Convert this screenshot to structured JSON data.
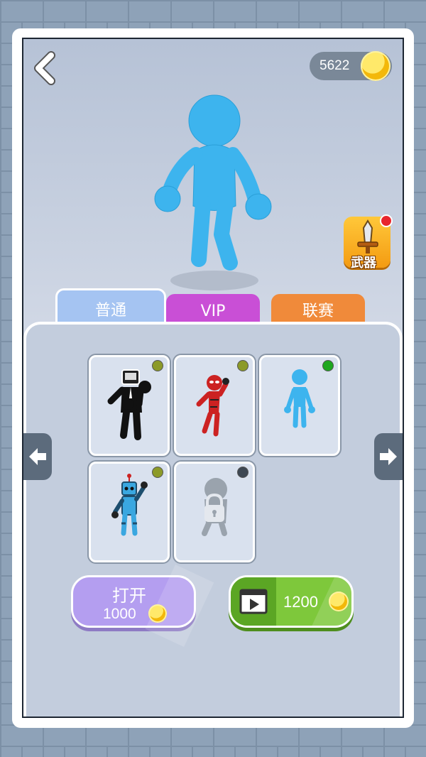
{
  "header": {
    "coins": "5622"
  },
  "weapon_button": {
    "label": "武器"
  },
  "tabs": [
    {
      "label": "普通",
      "active": true
    },
    {
      "label": "VIP",
      "active": false
    },
    {
      "label": "联赛",
      "active": false
    }
  ],
  "skins": [
    {
      "name": "suit-stickman",
      "status_color": "#8c9a28"
    },
    {
      "name": "red-hero-stickman",
      "status_color": "#8c9a28"
    },
    {
      "name": "blue-stickman",
      "status_color": "#1fa71f"
    },
    {
      "name": "robot-stickman",
      "status_color": "#8c9a28"
    },
    {
      "name": "locked-skin",
      "status_color": "#3d4752",
      "locked": true
    }
  ],
  "open_button": {
    "label": "打开",
    "price": "1000"
  },
  "video_button": {
    "price": "1200"
  },
  "colors": {
    "accent_blue": "#38b6f0",
    "tab_vip": "#c94fd6",
    "tab_league": "#f08a3a",
    "video_green": "#7ec83b",
    "open_purple": "#b49ef0"
  }
}
